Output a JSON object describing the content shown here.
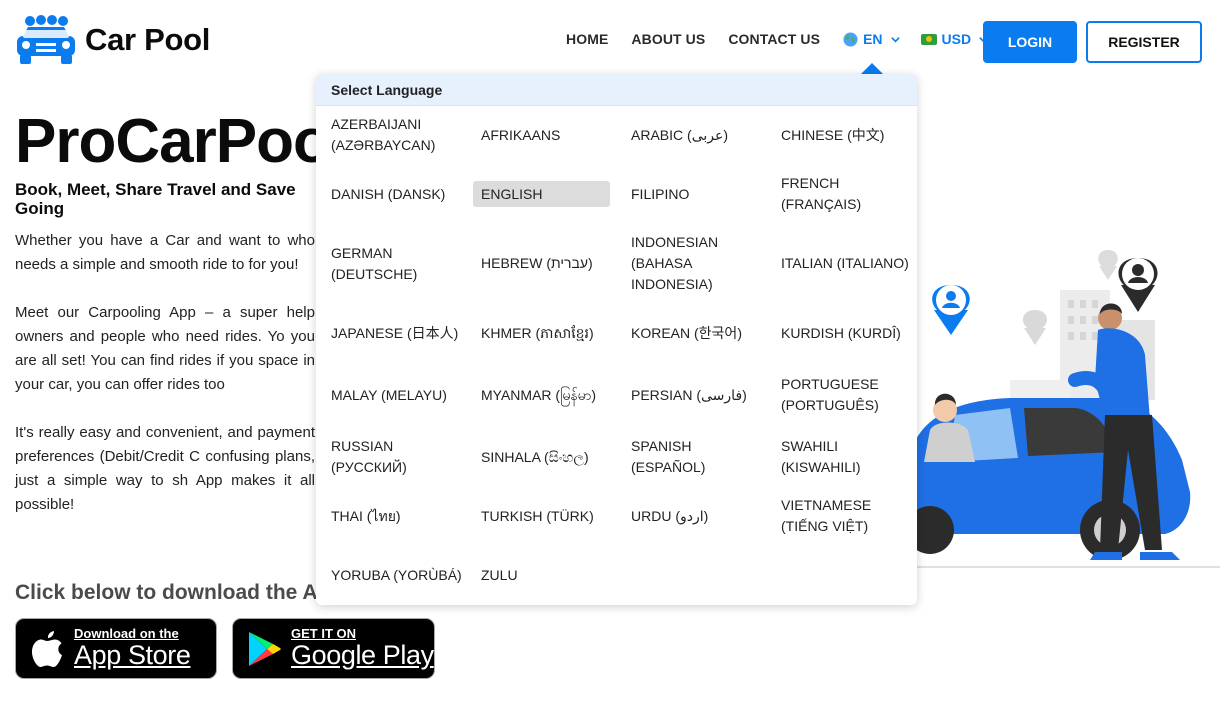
{
  "brand": {
    "name": "Car Pool"
  },
  "nav": {
    "home": "HOME",
    "about": "ABOUT US",
    "contact": "CONTACT US",
    "language": "EN",
    "currency": "USD",
    "login": "LOGIN",
    "register": "REGISTER"
  },
  "hero": {
    "title": "ProCarPool",
    "subtitle": "Book, Meet, Share Travel and Save Going",
    "paragraphs": [
      "Whether you have a Car and want to who needs a simple and smooth ride to for you!",
      "Meet our Carpooling App – a super help owners and people who need rides. Yo you are all set! You can find rides if you space in your car, you can offer rides too",
      "It's really easy and convenient, and payment preferences (Debit/Credit C confusing plans, just a simple way to sh App makes it all possible!"
    ],
    "download_title": "Click below to download the App"
  },
  "stores": {
    "apple": {
      "small": "Download on the",
      "big": "App Store"
    },
    "google": {
      "small": "GET IT ON",
      "big": "Google Play"
    }
  },
  "language_dropdown": {
    "header": "Select Language",
    "selected": "ENGLISH",
    "languages": [
      "AZERBAIJANI (AZƏRBAYCAN)",
      "AFRIKAANS",
      "ARABIC (عربى)",
      "CHINESE (中文)",
      "DANISH (DANSK)",
      "ENGLISH",
      "FILIPINO",
      "FRENCH (FRANÇAIS)",
      "GERMAN (DEUTSCHE)",
      "HEBREW (עברית)",
      "INDONESIAN (BAHASA INDONESIA)",
      "ITALIAN (ITALIANO)",
      "JAPANESE (日本人)",
      "KHMER (ភាសាខ្មែរ)",
      "KOREAN (한국어)",
      "KURDISH (KURDÎ)",
      "MALAY (MELAYU)",
      "MYANMAR (မြန်မာ)",
      "PERSIAN (فارسی)",
      "PORTUGUESE (PORTUGUÊS)",
      "RUSSIAN (РУССКИЙ)",
      "SINHALA (සිංහල)",
      "SPANISH (ESPAÑOL)",
      "SWAHILI (KISWAHILI)",
      "THAI (ไทย)",
      "TURKISH (TÜRK)",
      "URDU (اردو)",
      "VIETNAMESE (TIẾNG VIỆT)",
      "YORUBA (YORÙBÁ)",
      "ZULU"
    ]
  },
  "colors": {
    "accent": "#0a7cf0",
    "dropdown_header": "#e7f1fe"
  }
}
